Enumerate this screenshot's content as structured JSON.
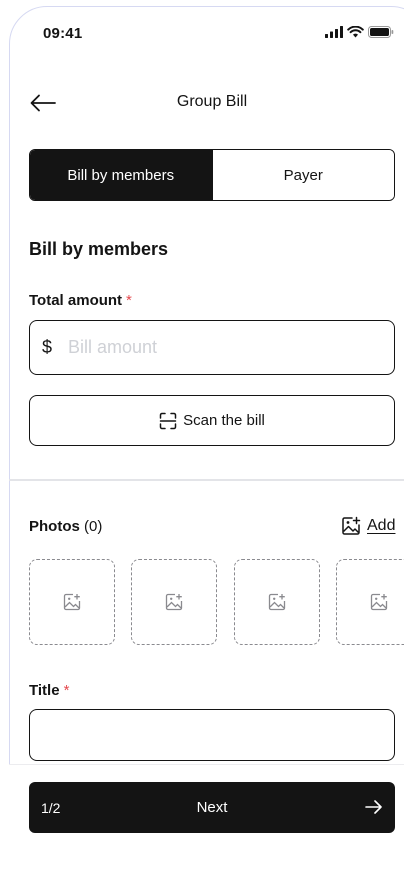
{
  "status": {
    "time": "09:41"
  },
  "header": {
    "title": "Group Bill"
  },
  "tabs": [
    {
      "label": "Bill by members",
      "active": true
    },
    {
      "label": "Payer",
      "active": false
    }
  ],
  "section": {
    "title": "Bill by members"
  },
  "amount": {
    "label": "Total amount",
    "required_mark": "*",
    "currency": "$",
    "placeholder": "Bill amount",
    "value": ""
  },
  "scan": {
    "label": "Scan the bill"
  },
  "photos": {
    "label": "Photos",
    "count": "(0)",
    "add_label": "Add",
    "slots": 4
  },
  "title_field": {
    "label": "Title",
    "required_mark": "*",
    "value": ""
  },
  "footer": {
    "step": "1/2",
    "next_label": "Next"
  },
  "colors": {
    "primary": "#141414",
    "required": "#e5484d",
    "placeholder": "#cfd1d6",
    "dashed_border": "#8a8a8f"
  }
}
